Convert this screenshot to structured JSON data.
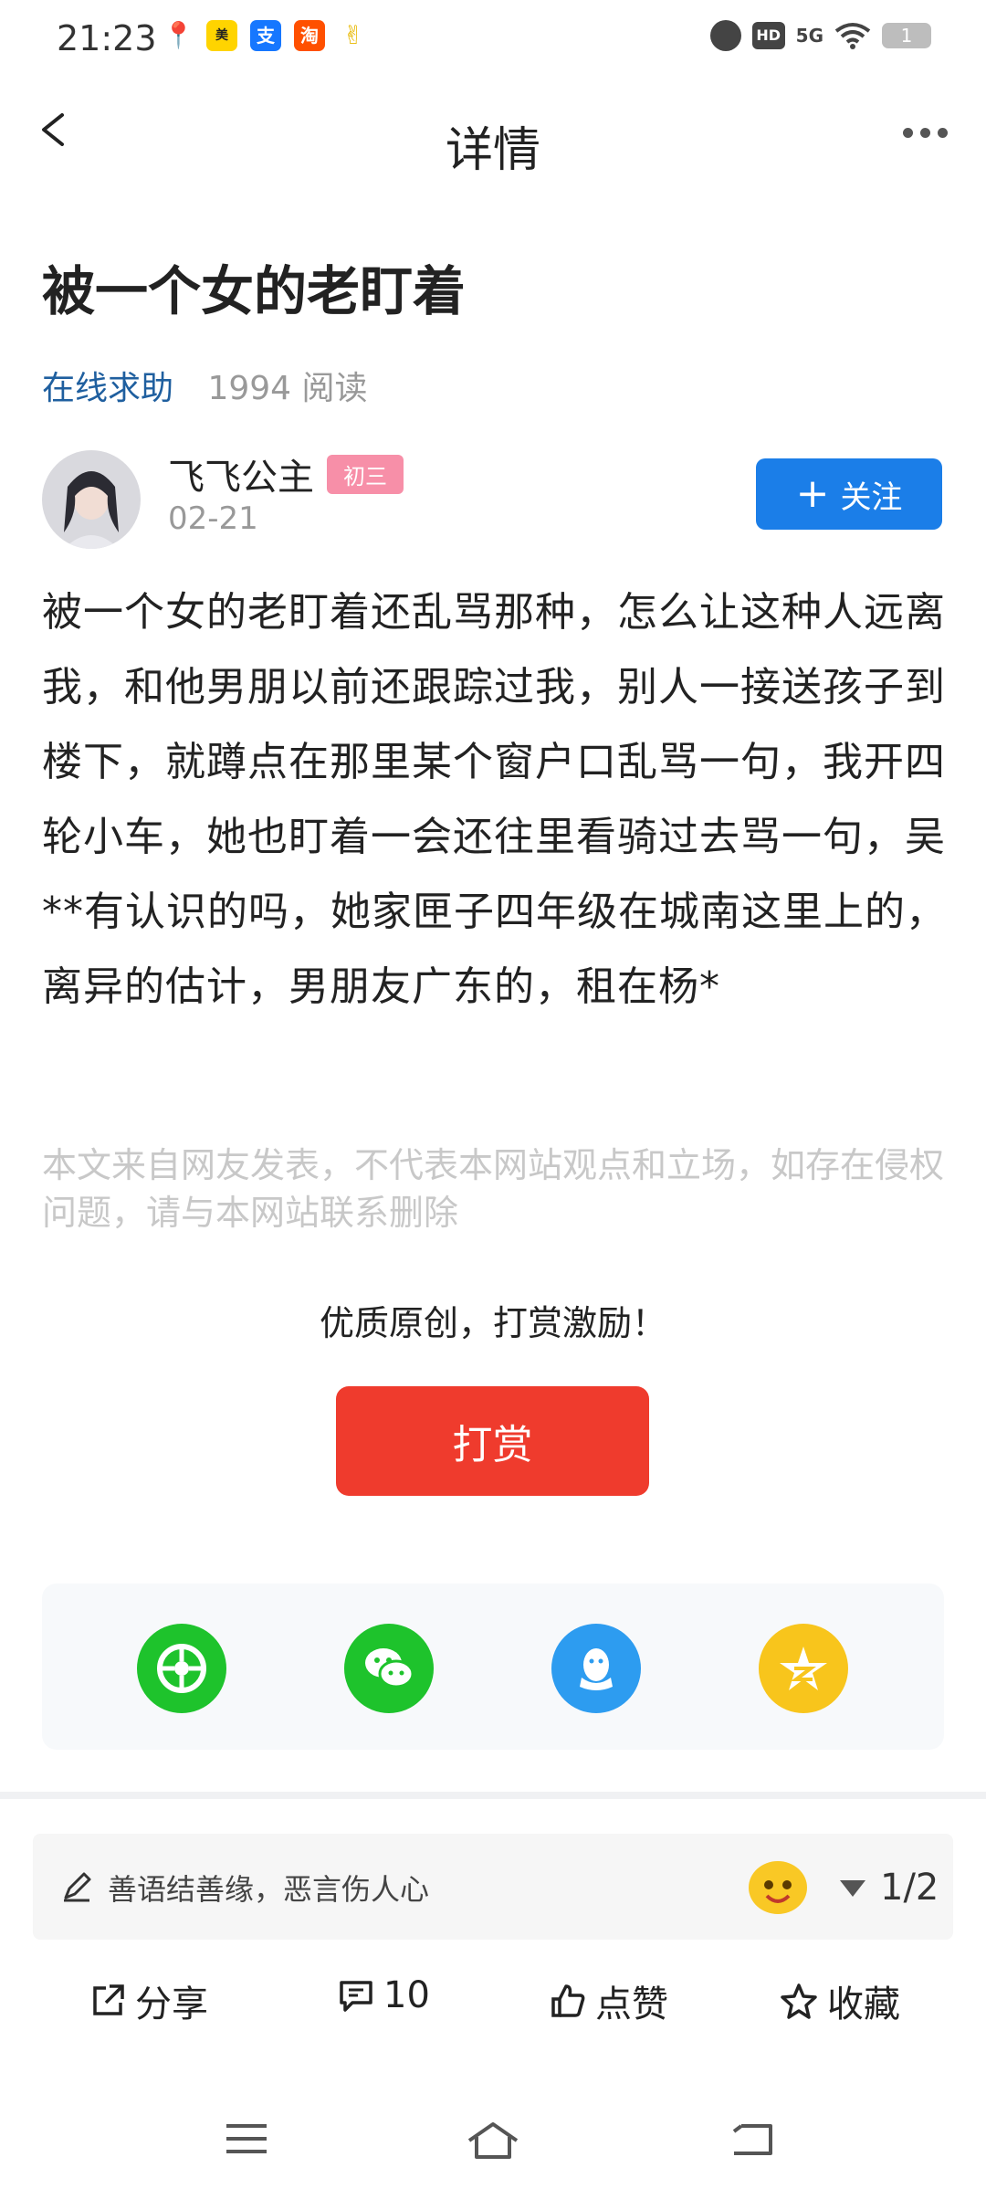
{
  "status_bar": {
    "time": "21:23",
    "app_icons": [
      "map-pin-icon",
      "meituan-icon",
      "alipay-icon",
      "taobao-icon",
      "mascot-icon"
    ],
    "network": "5G",
    "hd": "HD",
    "battery": "1"
  },
  "nav": {
    "title": "详情"
  },
  "post": {
    "title": "被一个女的老盯着",
    "category": "在线求助",
    "reads": "1994 阅读",
    "author": "飞飞公主",
    "badge": "初三",
    "date": "02-21",
    "follow_label": "关注",
    "body": "被一个女的老盯着还乱骂那种，怎么让这种人远离我，和他男朋以前还跟踪过我，别人一接送孩子到楼下，就蹲点在那里某个窗户口乱骂一句，我开四轮小车，她也盯着一会还往里看骑过去骂一句，吴**有认识的吗，她家匣子四年级在城南这里上的，离异的估计，男朋友广东的，租在杨*",
    "disclaimer": "本文来自网友发表，不代表本网站观点和立场，如存在侵权问题，请与本网站联系删除"
  },
  "reward": {
    "tip": "优质原创，打赏激励！",
    "button": "打赏"
  },
  "share": {
    "targets": [
      "moments",
      "wechat",
      "qq",
      "qzone"
    ],
    "colors": {
      "moments": "#1ec32c",
      "wechat": "#1ec32c",
      "qq": "#2d9cf0",
      "qzone": "#f8c51c"
    }
  },
  "comment": {
    "placeholder": "善语结善缘，恶言伤人心",
    "page": "1/2"
  },
  "actions": {
    "share": "分享",
    "comments": "10",
    "like": "点赞",
    "favorite": "收藏"
  },
  "colors": {
    "accent": "#1b7ee8",
    "reward": "#ef3b2d",
    "category": "#1f5f9f"
  }
}
